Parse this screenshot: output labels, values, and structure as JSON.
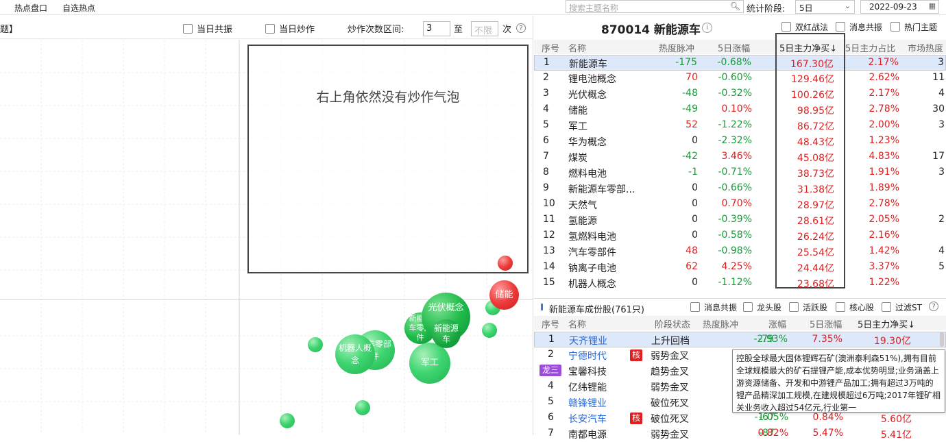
{
  "topbar": {
    "tabs": [
      "热点盘口",
      "自选热点"
    ],
    "search_placeholder": "搜索主题名称",
    "period_label": "统计阶段:",
    "period_value": "5日",
    "date_value": "2022-09-23"
  },
  "left_panel": {
    "bracket_text": "题】",
    "opt_resonance": "当日共振",
    "opt_hype": "当日炒作",
    "range_label": "炒作次数区间:",
    "range_from": "3",
    "range_to_label": "至",
    "range_to_placeholder": "不限",
    "range_unit": "次",
    "annotation": "右上角依然没有炒作气泡",
    "bubbles": [
      {
        "label": "光伏概念",
        "color": "green"
      },
      {
        "label": "新能源车",
        "color": "green"
      },
      {
        "label": "新能源车零部件",
        "color": "green"
      },
      {
        "label": "汽车零部件",
        "color": "green"
      },
      {
        "label": "机器人概念",
        "color": "green"
      },
      {
        "label": "军工",
        "color": "green"
      },
      {
        "label": "储能",
        "color": "red"
      }
    ]
  },
  "right_panel": {
    "title": "870014 新能源车",
    "options": [
      "双红战法",
      "消息共振",
      "热门主题"
    ],
    "columns": [
      "序号",
      "名称",
      "热度脉冲",
      "5日涨幅",
      "5日主力净买↓",
      "5日主力占比",
      "市场热度"
    ],
    "rows": [
      {
        "no": "1",
        "name": "新能源车",
        "pulse": "-175",
        "chg": "-0.68%",
        "net": "167.30亿",
        "ratio": "2.17%",
        "heat": "3"
      },
      {
        "no": "2",
        "name": "锂电池概念",
        "pulse": "70",
        "chg": "-0.60%",
        "net": "129.46亿",
        "ratio": "2.62%",
        "heat": "11"
      },
      {
        "no": "3",
        "name": "光伏概念",
        "pulse": "-48",
        "chg": "-0.32%",
        "net": "100.26亿",
        "ratio": "2.17%",
        "heat": "4"
      },
      {
        "no": "4",
        "name": "储能",
        "pulse": "-49",
        "chg": "0.10%",
        "net": "98.95亿",
        "ratio": "2.78%",
        "heat": "30"
      },
      {
        "no": "5",
        "name": "军工",
        "pulse": "52",
        "chg": "-1.22%",
        "net": "86.72亿",
        "ratio": "2.00%",
        "heat": "3"
      },
      {
        "no": "6",
        "name": "华为概念",
        "pulse": "0",
        "chg": "-2.32%",
        "net": "48.43亿",
        "ratio": "1.23%",
        "heat": ""
      },
      {
        "no": "7",
        "name": "煤炭",
        "pulse": "-42",
        "chg": "3.46%",
        "net": "45.08亿",
        "ratio": "4.83%",
        "heat": "17"
      },
      {
        "no": "8",
        "name": "燃料电池",
        "pulse": "-1",
        "chg": "-0.71%",
        "net": "38.73亿",
        "ratio": "1.91%",
        "heat": "3"
      },
      {
        "no": "9",
        "name": "新能源车零部...",
        "pulse": "0",
        "chg": "-0.66%",
        "net": "31.38亿",
        "ratio": "1.89%",
        "heat": ""
      },
      {
        "no": "10",
        "name": "天然气",
        "pulse": "0",
        "chg": "0.70%",
        "net": "28.97亿",
        "ratio": "2.78%",
        "heat": ""
      },
      {
        "no": "11",
        "name": "氢能源",
        "pulse": "0",
        "chg": "-0.39%",
        "net": "28.61亿",
        "ratio": "2.05%",
        "heat": "2"
      },
      {
        "no": "12",
        "name": "氢燃料电池",
        "pulse": "0",
        "chg": "-0.58%",
        "net": "26.24亿",
        "ratio": "2.16%",
        "heat": ""
      },
      {
        "no": "13",
        "name": "汽车零部件",
        "pulse": "48",
        "chg": "-0.98%",
        "net": "25.54亿",
        "ratio": "1.42%",
        "heat": "4"
      },
      {
        "no": "14",
        "name": "钠离子电池",
        "pulse": "62",
        "chg": "4.25%",
        "net": "24.44亿",
        "ratio": "3.37%",
        "heat": "5"
      },
      {
        "no": "15",
        "name": "机器人概念",
        "pulse": "0",
        "chg": "-1.12%",
        "net": "23.68亿",
        "ratio": "1.22%",
        "heat": ""
      }
    ],
    "stocks_title": "新能源车成份股(761只)",
    "stock_options": [
      "消息共振",
      "龙头股",
      "活跃股",
      "核心股",
      "过滤ST"
    ],
    "stock_columns": [
      "序号",
      "名称",
      "阶段状态",
      "热度脉冲",
      "涨幅",
      "5日涨幅",
      "5日主力净买↓"
    ],
    "stocks": [
      {
        "no": "1",
        "name": "天齐锂业",
        "tag": "",
        "state": "上升回档",
        "pulse": "-79",
        "chg": "-2.93%",
        "chg5": "7.35%",
        "net": "19.30亿"
      },
      {
        "no": "2",
        "name": "宁德时代",
        "tag": "核",
        "state": "弱势金叉",
        "pulse": "-",
        "chg": "",
        "chg5": "",
        "net": ""
      },
      {
        "no": "",
        "name": "宝馨科技",
        "tag": "龙三",
        "state": "趋势金叉",
        "pulse": "-",
        "chg": "",
        "chg5": "",
        "net": ""
      },
      {
        "no": "4",
        "name": "亿纬锂能",
        "tag": "",
        "state": "弱势金叉",
        "pulse": "-10",
        "chg": "",
        "chg5": "",
        "net": ""
      },
      {
        "no": "5",
        "name": "赣锋锂业",
        "tag": "",
        "state": "破位死叉",
        "pulse": "-1",
        "chg": "",
        "chg5": "",
        "net": ""
      },
      {
        "no": "6",
        "name": "长安汽车",
        "tag": "核",
        "state": "破位死叉",
        "pulse": "-67",
        "chg": "-1.05%",
        "chg5": "0.84%",
        "net": "5.60亿"
      },
      {
        "no": "7",
        "name": "南都电源",
        "tag": "",
        "state": "弱势金叉",
        "pulse": "-87",
        "chg": "0.82%",
        "chg5": "5.47%",
        "net": "5.41亿"
      }
    ],
    "tooltip": "控股全球最大固体锂辉石矿(澳洲泰利森51%),拥有目前全球规模最大的矿石提锂产能,成本优势明显;业务涵盖上游资源储备、开发和中游锂产品加工;拥有超过3万吨的锂产品精深加工规模,在建规模超过6万吨;2017年锂矿相关业务收入超过54亿元,行业第一"
  }
}
